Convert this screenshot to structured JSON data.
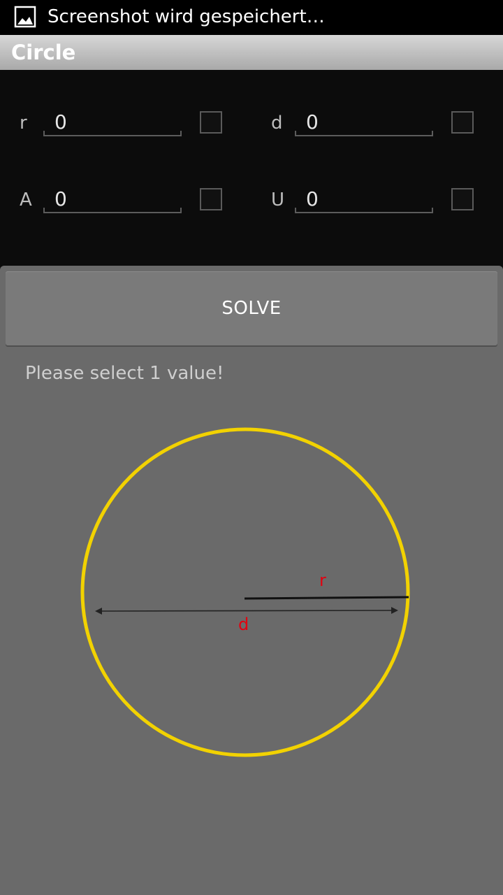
{
  "status_bar": {
    "notification_icon": "image-icon",
    "text": "Screenshot wird gespeichert…"
  },
  "title_bar": {
    "title": "Circle"
  },
  "fields": [
    {
      "id": "r",
      "label": "r",
      "value": "0",
      "checked": false
    },
    {
      "id": "d",
      "label": "d",
      "value": "0",
      "checked": false
    },
    {
      "id": "A",
      "label": "A",
      "value": "0",
      "checked": false
    },
    {
      "id": "U",
      "label": "U",
      "value": "0",
      "checked": false
    }
  ],
  "solve_button": {
    "label": "SOLVE"
  },
  "hint": "Please select 1 value!",
  "diagram": {
    "radius_label": "r",
    "diameter_label": "d",
    "circle_color": "#f2d200",
    "label_color": "#e3000f"
  }
}
